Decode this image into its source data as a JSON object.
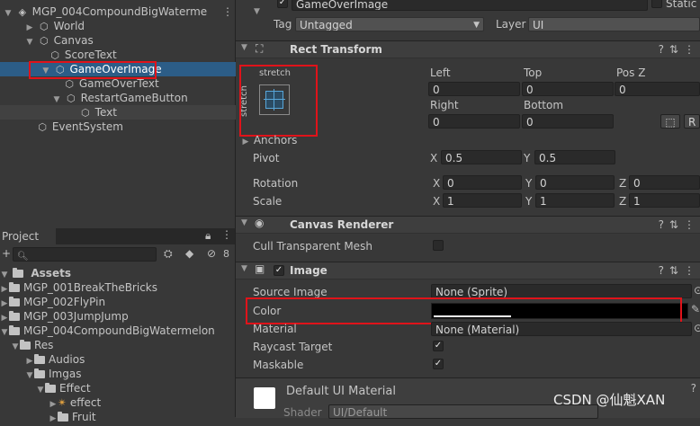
{
  "hierarchy": {
    "scene": "MGP_004CompoundBigWaterme",
    "items": [
      {
        "label": "World"
      },
      {
        "label": "Canvas"
      },
      {
        "label": "ScoreText"
      },
      {
        "label": "GameOverImage"
      },
      {
        "label": "GameOverText"
      },
      {
        "label": "RestartGameButton"
      },
      {
        "label": "Text"
      },
      {
        "label": "EventSystem"
      }
    ]
  },
  "project": {
    "tab": "Project",
    "add_label": "+",
    "badge": "8",
    "search_placeholder": "",
    "assets_label": "Assets",
    "folders": [
      {
        "label": "MGP_001BreakTheBricks"
      },
      {
        "label": "MGP_002FlyPin"
      },
      {
        "label": "MGP_003JumpJump"
      },
      {
        "label": "MGP_004CompoundBigWatermelon"
      },
      {
        "label": "Res"
      },
      {
        "label": "Audios"
      },
      {
        "label": "Imgas"
      },
      {
        "label": "Effect"
      },
      {
        "label": "effect"
      },
      {
        "label": "Fruit"
      }
    ]
  },
  "inspector": {
    "object_name": "GameOverImage",
    "static_label": "Static",
    "tag_label": "Tag",
    "tag_value": "Untagged",
    "layer_label": "Layer",
    "layer_value": "UI",
    "rect_transform": {
      "title": "Rect Transform",
      "anchor_top": "stretch",
      "anchor_side": "stretch",
      "left_label": "Left",
      "left_value": "0",
      "top_label": "Top",
      "top_value": "0",
      "posz_label": "Pos Z",
      "posz_value": "0",
      "right_label": "Right",
      "right_value": "0",
      "bottom_label": "Bottom",
      "bottom_value": "0",
      "anchors_label": "Anchors",
      "pivot_label": "Pivot",
      "pivot_x": "0.5",
      "pivot_y": "0.5",
      "rotation_label": "Rotation",
      "rot_x": "0",
      "rot_y": "0",
      "rot_z": "0",
      "scale_label": "Scale",
      "scale_x": "1",
      "scale_y": "1",
      "scale_z": "1",
      "x": "X",
      "y": "Y",
      "z": "Z",
      "r_button": "R"
    },
    "canvas_renderer": {
      "title": "Canvas Renderer",
      "cull_label": "Cull Transparent Mesh"
    },
    "image": {
      "title": "Image",
      "source_label": "Source Image",
      "source_value": "None (Sprite)",
      "color_label": "Color",
      "color_value": "#000000",
      "material_label": "Material",
      "material_value": "None (Material)",
      "raycast_label": "Raycast Target",
      "maskable_label": "Maskable"
    },
    "material_section": {
      "title": "Default UI Material",
      "shader_label": "Shader",
      "shader_value": "UI/Default"
    }
  },
  "watermark": "CSDN @仙魁XAN",
  "colors": {
    "highlight": "#e0131a",
    "selection": "#2c5d87"
  }
}
